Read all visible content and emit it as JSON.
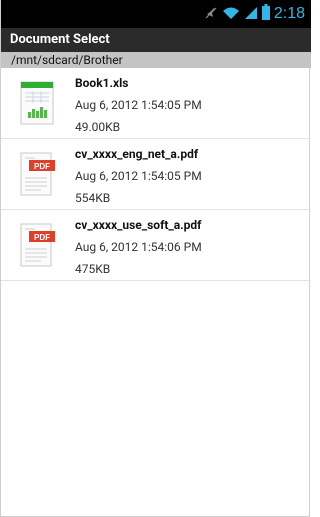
{
  "status_bar": {
    "time": "2:18"
  },
  "header": {
    "title": "Document Select"
  },
  "path": {
    "current": "/mnt/sdcard/Brother"
  },
  "files": [
    {
      "name": "Book1.xls",
      "date": "Aug 6, 2012 1:54:05 PM",
      "size": "49.00KB",
      "icon": "xls-file-icon"
    },
    {
      "name": "cv_xxxx_eng_net_a.pdf",
      "date": "Aug 6, 2012 1:54:05 PM",
      "size": "554KB",
      "icon": "pdf-file-icon"
    },
    {
      "name": "cv_xxxx_use_soft_a.pdf",
      "date": "Aug 6, 2012 1:54:06 PM",
      "size": "475KB",
      "icon": "pdf-file-icon"
    }
  ],
  "icons": {
    "pdf_badge": "PDF"
  },
  "colors": {
    "accent": "#33b5e5",
    "pdf_red": "#e0402a",
    "xls_green": "#3aa03a"
  }
}
